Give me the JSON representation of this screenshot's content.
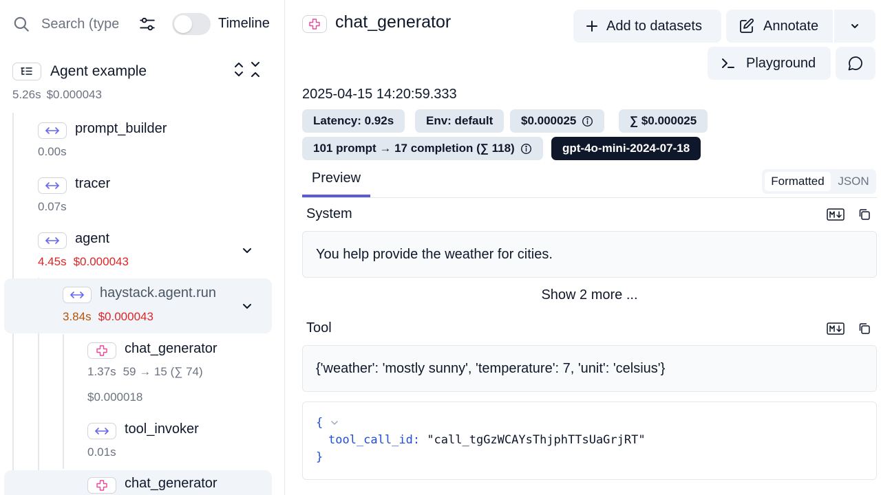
{
  "sidebar": {
    "search_placeholder": "Search (type",
    "timeline_label": "Timeline",
    "root": {
      "title": "Agent example",
      "duration": "5.26s",
      "cost": "$0.000043"
    },
    "nodes": [
      {
        "title": "prompt_builder",
        "duration": "0.00s"
      },
      {
        "title": "tracer",
        "duration": "0.07s"
      },
      {
        "title": "agent",
        "duration": "4.45s",
        "cost": "$0.000043"
      },
      {
        "title": "haystack.agent.run",
        "duration": "3.84s",
        "cost": "$0.000043"
      },
      {
        "title": "chat_generator",
        "duration": "1.37s",
        "tokens": "59 → 15 (∑ 74)",
        "cost": "$0.000018"
      },
      {
        "title": "tool_invoker",
        "duration": "0.01s"
      },
      {
        "title": "chat_generator"
      }
    ]
  },
  "main": {
    "title": "chat_generator",
    "buttons": {
      "add_to_datasets": "Add to datasets",
      "annotate": "Annotate",
      "playground": "Playground"
    },
    "timestamp": "2025-04-15 14:20:59.333",
    "chips": {
      "latency": "Latency: 0.92s",
      "env": "Env: default",
      "cost": "$0.000025",
      "total_cost": "∑ $0.000025",
      "tokens": "101 prompt → 17 completion (∑ 118)",
      "model": "gpt-4o-mini-2024-07-18"
    },
    "tabs": {
      "preview": "Preview",
      "formatted": "Formatted",
      "json": "JSON"
    },
    "system": {
      "label": "System",
      "text": "You help provide the weather for cities.",
      "show_more": "Show 2 more ..."
    },
    "tool": {
      "label": "Tool",
      "text": "{'weather': 'mostly sunny', 'temperature': 7, 'unit': 'celsius'}",
      "code_open": "{",
      "code_key": "tool_call_id:",
      "code_value": "\"call_tgGzWCAYsThjphTTsUaGrjRT\"",
      "code_close": "}"
    }
  },
  "colors": {
    "accent": "#5b5bd6",
    "cost_red": "#dc2626",
    "duration_amber": "#b45309",
    "chip_bg": "#e2e8f0",
    "model_chip_bg": "#0f172a",
    "span_icon_indigo": "#6366f1",
    "llm_icon_pink": "#ec4899"
  },
  "icons": {
    "search": "search-icon",
    "filter": "sliders-icon",
    "span": "arrow-left-right-icon",
    "llm": "llm-icon",
    "tree": "list-tree-icon",
    "expand": "chevrons-up-down-icon",
    "collapse": "chevrons-down-up-icon",
    "chevron": "chevron-down-icon",
    "plus": "plus-icon",
    "edit": "pencil-square-icon",
    "terminal": "terminal-icon",
    "comment": "message-circle-icon",
    "info": "info-icon",
    "markdown": "markdown-icon",
    "copy": "copy-icon"
  }
}
